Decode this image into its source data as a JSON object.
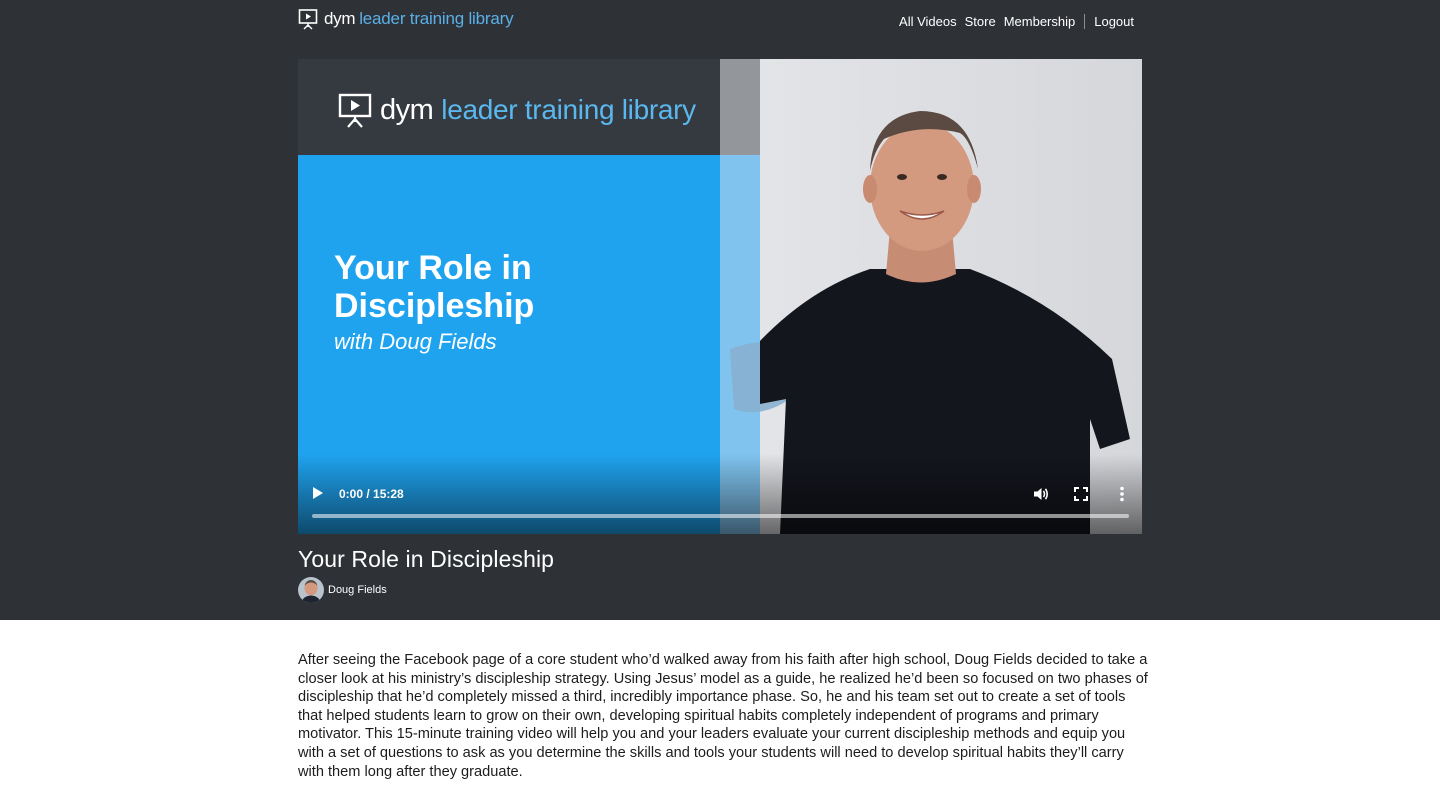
{
  "brand": {
    "dym": "dym",
    "rest": "leader training library",
    "accent": "#5ab0e8"
  },
  "nav": {
    "items": [
      "All Videos",
      "Store",
      "Membership"
    ],
    "logout": "Logout"
  },
  "video": {
    "slide_logo_dym": "dym",
    "slide_logo_rest": "leader training library",
    "slide_title_line1": "Your Role in",
    "slide_title_line2": "Discipleship",
    "slide_subtitle": "with Doug Fields",
    "time": "0:00 / 15:28",
    "progress": 0
  },
  "page": {
    "title": "Your Role in Discipleship",
    "author": "Doug Fields",
    "description": "After seeing the Facebook page of a core student who’d walked away from his faith after high school, Doug Fields decided to take a closer look at his ministry’s discipleship strategy. Using Jesus’ model as a guide, he realized he’d been so focused on two phases of discipleship that he’d completely missed a third, incredibly importance phase. So, he and his team set out to create a set of tools that helped students learn to grow on their own, developing spiritual habits completely independent of programs and primary motivator. This 15-minute training video will help you and your leaders evaluate your current discipleship methods and equip you with a set of questions to ask as you determine the skills and tools your students will need to develop spiritual habits they’ll carry with them long after they graduate."
  },
  "colors": {
    "header_bg": "#2e3136",
    "slide_blue": "#1fa3ef",
    "slide_dark": "#353a41"
  },
  "icons": [
    "presentation-logo-icon",
    "play-icon",
    "volume-icon",
    "fullscreen-icon",
    "more-vertical-icon"
  ]
}
